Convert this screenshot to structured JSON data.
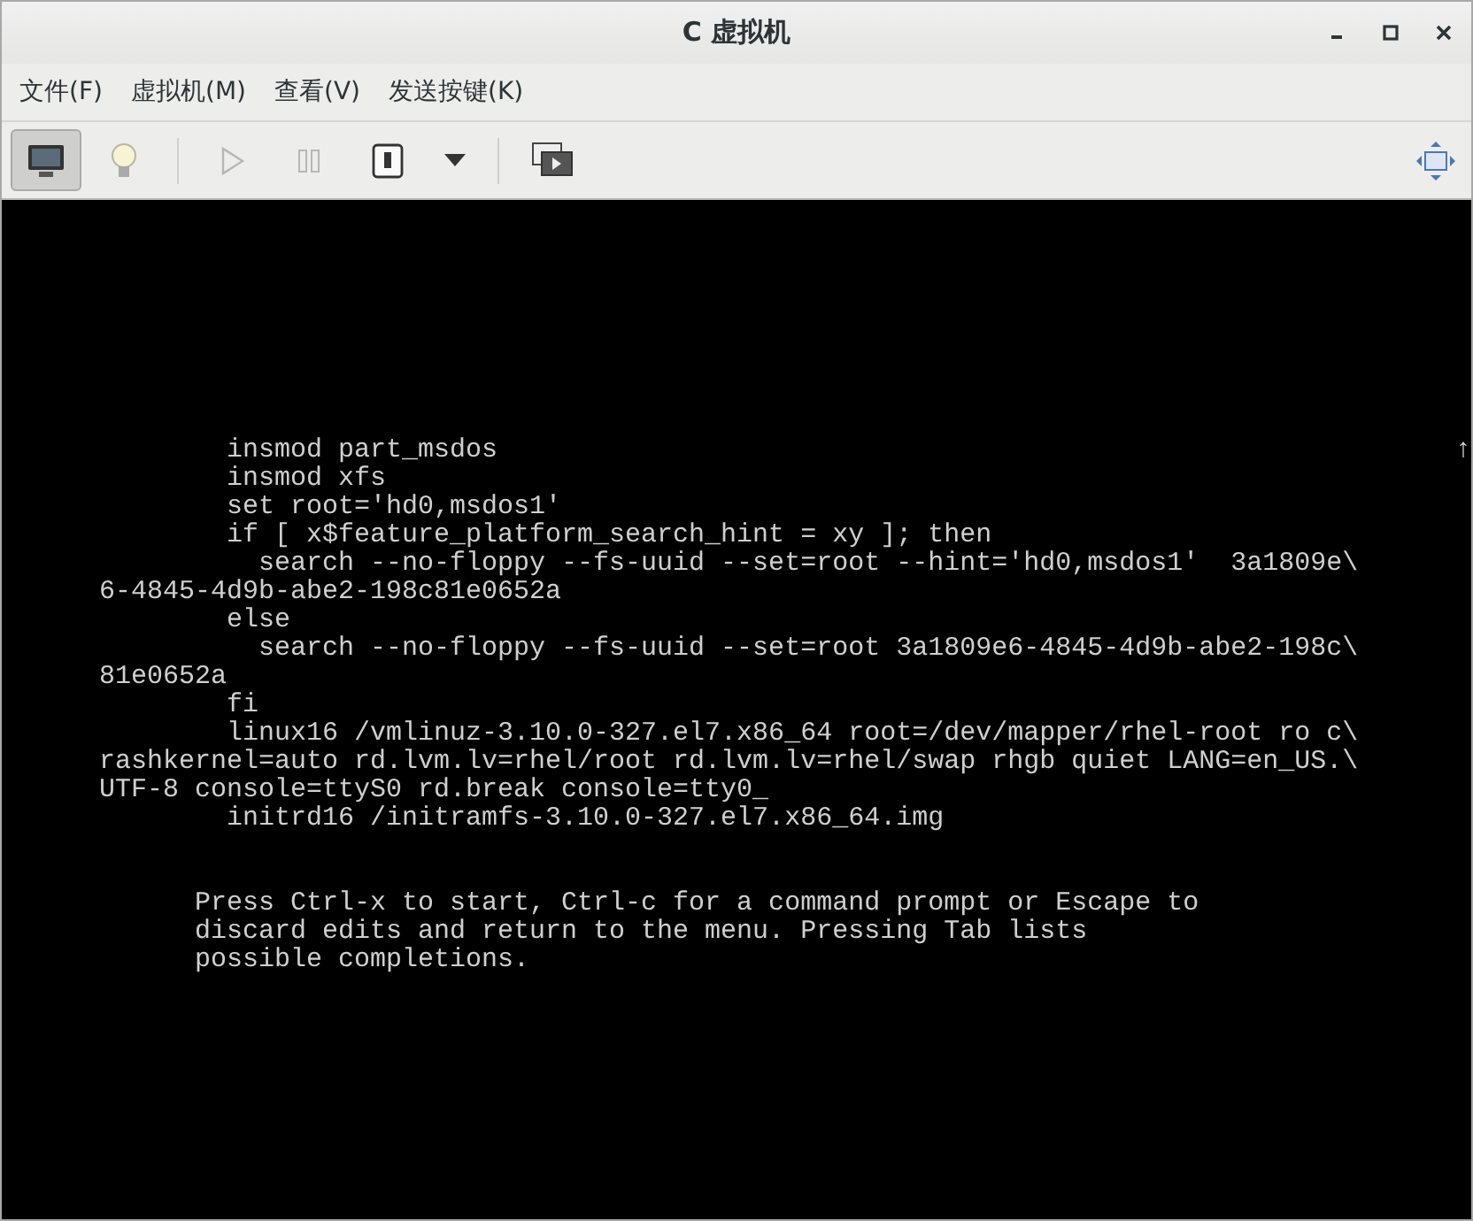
{
  "window": {
    "title": "C 虚拟机",
    "controls": [
      {
        "kind": "minimize"
      },
      {
        "kind": "maximize"
      },
      {
        "kind": "close"
      }
    ]
  },
  "menu": [
    "文件(F)",
    "虚拟机(M)",
    "查看(V)",
    "发送按键(K)"
  ],
  "toolbar": [
    {
      "kind": "monitor",
      "selected": true,
      "disabled": false
    },
    {
      "kind": "bulb",
      "selected": false,
      "disabled": false
    },
    {
      "kind": "separator"
    },
    {
      "kind": "play",
      "selected": false,
      "disabled": true
    },
    {
      "kind": "pause",
      "selected": false,
      "disabled": true
    },
    {
      "kind": "power",
      "selected": false,
      "disabled": false
    },
    {
      "kind": "caret",
      "selected": false,
      "disabled": false
    },
    {
      "kind": "separator"
    },
    {
      "kind": "screens",
      "selected": false,
      "disabled": false
    },
    {
      "kind": "spacer"
    },
    {
      "kind": "fullscreen",
      "selected": false,
      "disabled": false
    }
  ],
  "console": {
    "scroll_mark": "↑",
    "lines": [
      "        insmod part_msdos",
      "        insmod xfs",
      "        set root='hd0,msdos1'",
      "        if [ x$feature_platform_search_hint = xy ]; then",
      "          search --no-floppy --fs-uuid --set=root --hint='hd0,msdos1'  3a1809e\\",
      "6-4845-4d9b-abe2-198c81e0652a",
      "        else",
      "          search --no-floppy --fs-uuid --set=root 3a1809e6-4845-4d9b-abe2-198c\\",
      "81e0652a",
      "        fi",
      "        linux16 /vmlinuz-3.10.0-327.el7.x86_64 root=/dev/mapper/rhel-root ro c\\",
      "rashkernel=auto rd.lvm.lv=rhel/root rd.lvm.lv=rhel/swap rhgb quiet LANG=en_US.\\",
      "UTF-8 console=ttyS0 rd.break console=tty0_",
      "        initrd16 /initramfs-3.10.0-327.el7.x86_64.img"
    ],
    "help": [
      "      Press Ctrl-x to start, Ctrl-c for a command prompt or Escape to",
      "      discard edits and return to the menu. Pressing Tab lists",
      "      possible completions."
    ]
  }
}
